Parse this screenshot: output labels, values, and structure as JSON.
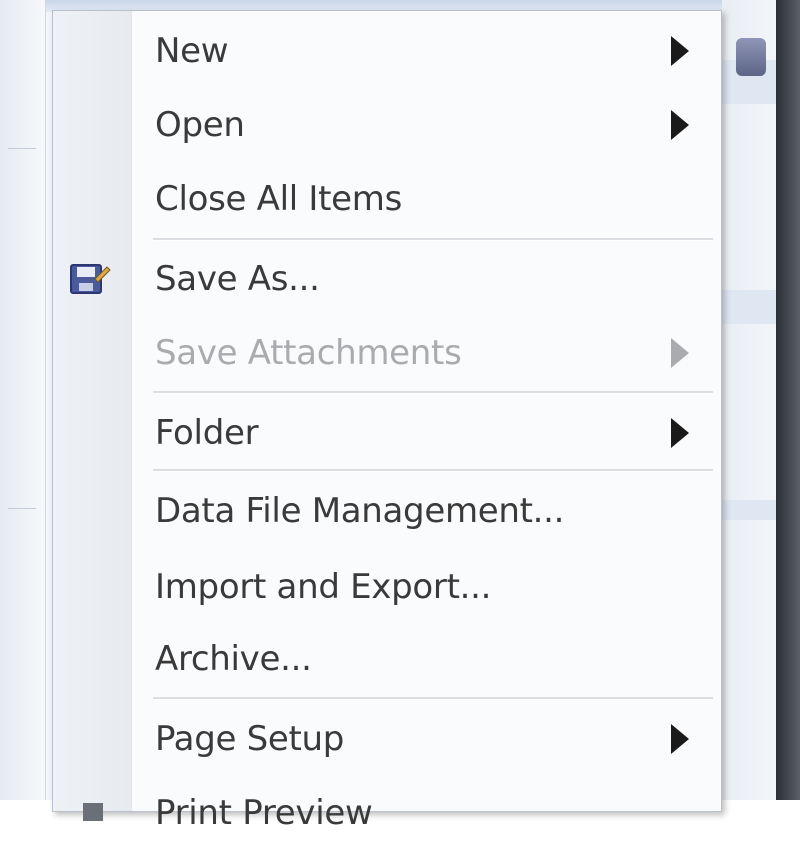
{
  "menu": {
    "items": [
      {
        "label": "New",
        "has_submenu": true,
        "enabled": true
      },
      {
        "label": "Open",
        "has_submenu": true,
        "enabled": true
      },
      {
        "label": "Close All Items",
        "has_submenu": false,
        "enabled": true
      },
      {
        "label": "Save As...",
        "has_submenu": false,
        "enabled": true,
        "icon": "save-as-icon"
      },
      {
        "label": "Save Attachments",
        "has_submenu": true,
        "enabled": false
      },
      {
        "label": "Folder",
        "has_submenu": true,
        "enabled": true
      },
      {
        "label": "Data File Management...",
        "has_submenu": false,
        "enabled": true
      },
      {
        "label": "Import and Export...",
        "has_submenu": false,
        "enabled": true
      },
      {
        "label": "Archive...",
        "has_submenu": false,
        "enabled": true
      },
      {
        "label": "Page Setup",
        "has_submenu": true,
        "enabled": true
      },
      {
        "label": "Print Preview",
        "has_submenu": false,
        "enabled": true,
        "icon": "print-preview-icon"
      }
    ]
  },
  "colors": {
    "menu_background": "#fafbfc",
    "text": "#3a3a3a",
    "disabled_text": "#a9abae",
    "separator": "#dadde2"
  }
}
